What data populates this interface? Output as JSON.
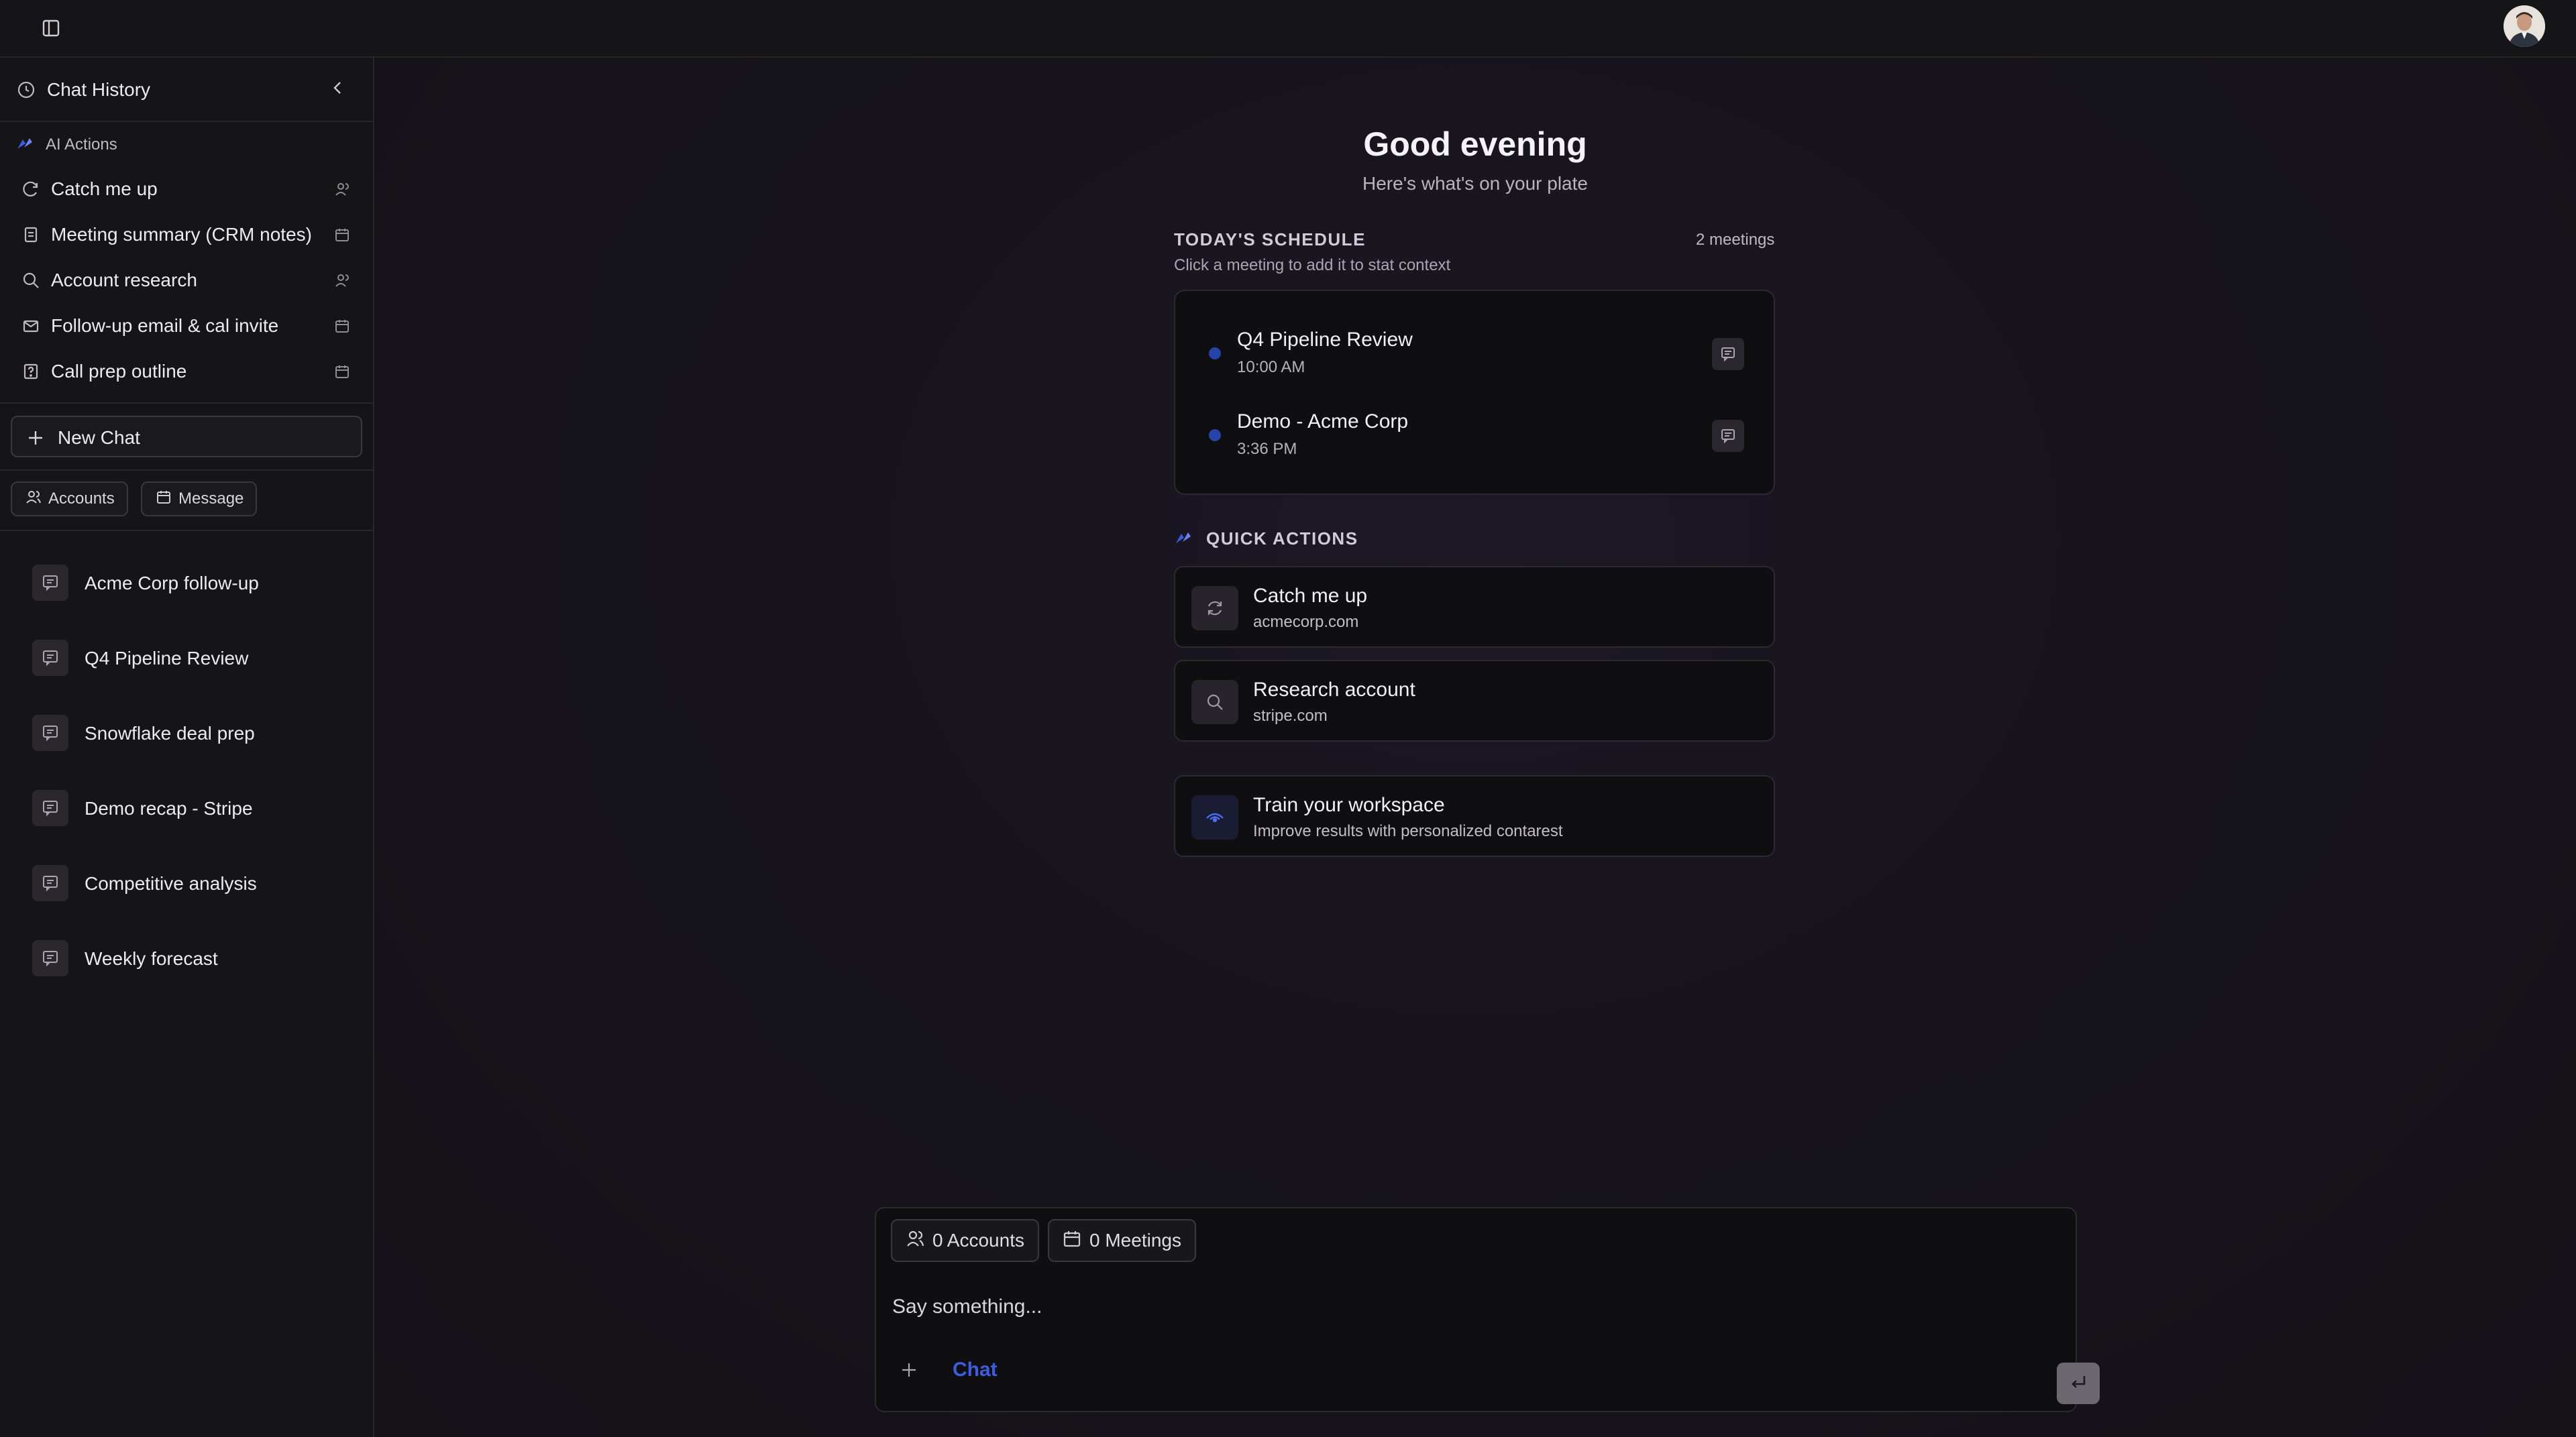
{
  "sidebar": {
    "title": "Chat History",
    "ai_actions_label": "AI Actions",
    "actions": [
      {
        "label": "Catch me up"
      },
      {
        "label": "Meeting summary (CRM notes)"
      },
      {
        "label": "Account research"
      },
      {
        "label": "Follow-up email & cal invite"
      },
      {
        "label": "Call prep outline"
      }
    ],
    "new_chat_label": "New Chat",
    "filters": {
      "accounts": "Accounts",
      "message": "Message"
    },
    "history": [
      {
        "label": "Acme Corp follow-up"
      },
      {
        "label": "Q4 Pipeline Review"
      },
      {
        "label": "Snowflake deal prep"
      },
      {
        "label": "Demo recap - Stripe"
      },
      {
        "label": "Competitive analysis"
      },
      {
        "label": "Weekly forecast"
      }
    ]
  },
  "main": {
    "greeting": "Good evening",
    "subgreeting": "Here's what's on your plate",
    "schedule": {
      "title": "TODAY'S SCHEDULE",
      "subtitle": "Click a meeting to add it to stat context",
      "count": "2 meetings",
      "meetings": [
        {
          "name": "Q4 Pipeline Review",
          "time": "10:00 AM"
        },
        {
          "name": "Demo - Acme Corp",
          "time": "3:36 PM"
        }
      ]
    },
    "quick_actions": {
      "title": "QUICK ACTIONS",
      "items": [
        {
          "title": "Catch me up",
          "subtitle": "acmecorp.com"
        },
        {
          "title": "Research account",
          "subtitle": "stripe.com"
        },
        {
          "title": "Train your workspace",
          "subtitle": "Improve results with personalized contarest"
        }
      ]
    },
    "composer": {
      "accounts_chip": "0 Accounts",
      "meetings_chip": "0 Meetings",
      "placeholder": "Say something...",
      "mode": "Chat"
    }
  },
  "colors": {
    "accent_blue": "#3b5ee0",
    "dot_blue": "#2742a8",
    "background": "#141217"
  }
}
